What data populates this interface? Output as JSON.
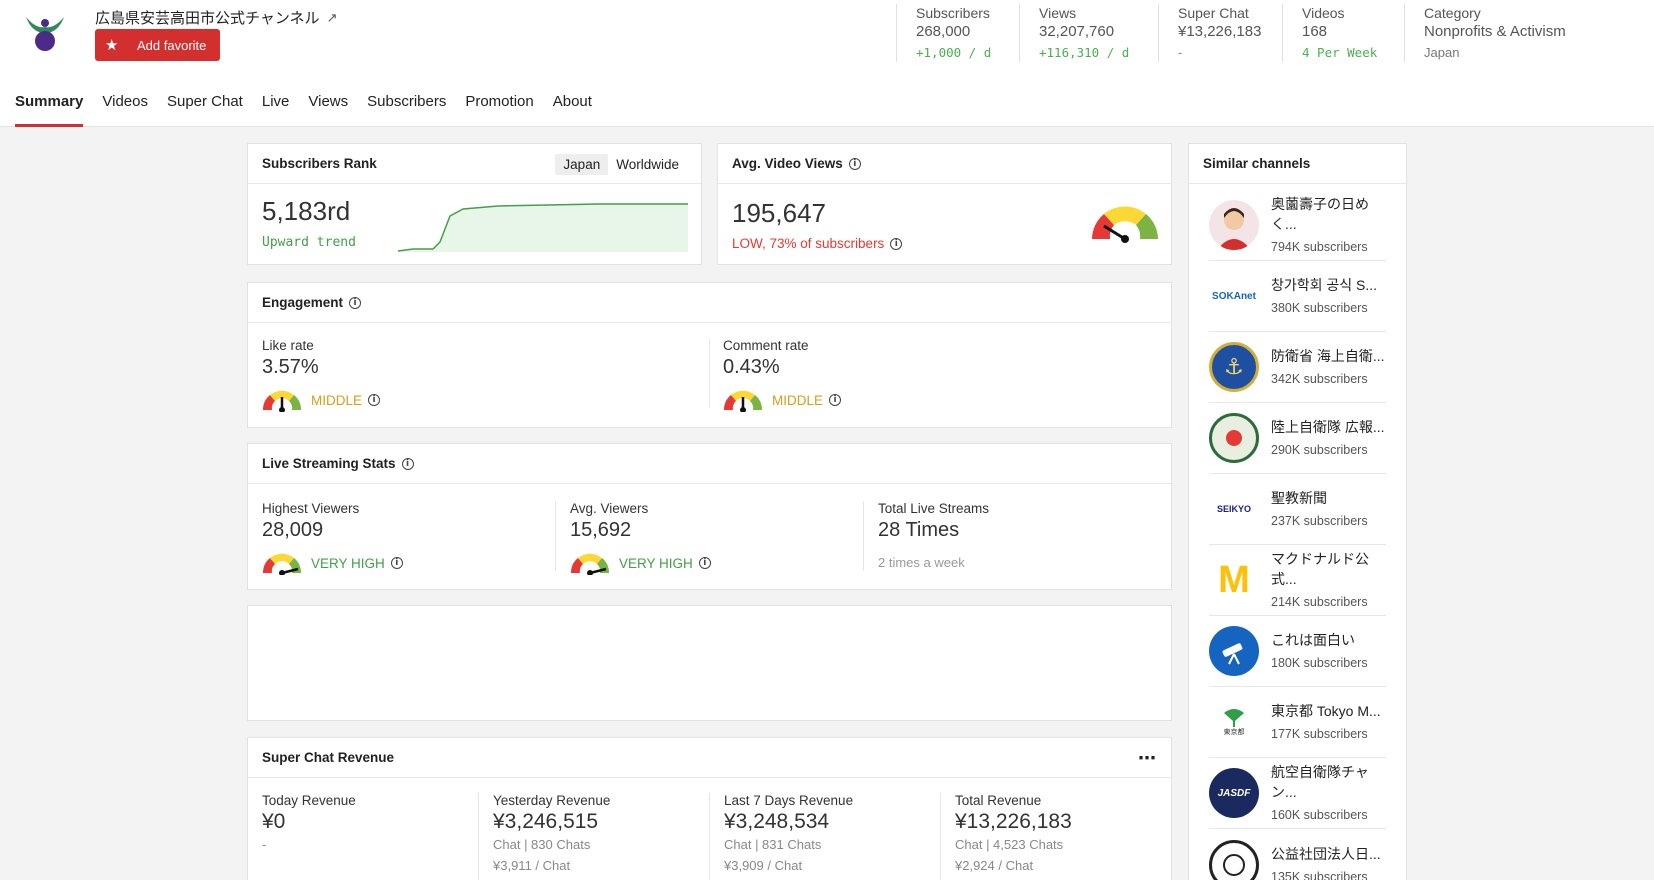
{
  "channel": {
    "title": "広島県安芸高田市公式チャンネル",
    "favorite_label": "Add favorite"
  },
  "stats": [
    {
      "label": "Subscribers",
      "value": "268,000",
      "sub": "+1,000 / d",
      "sub_style": "green"
    },
    {
      "label": "Views",
      "value": "32,207,760",
      "sub": "+116,310 / d",
      "sub_style": "green"
    },
    {
      "label": "Super Chat",
      "value": "¥13,226,183",
      "sub": "-",
      "sub_style": "gray"
    },
    {
      "label": "Videos",
      "value": "168",
      "sub": "4 Per Week",
      "sub_style": "green"
    },
    {
      "label": "Category",
      "value": "Nonprofits & Activism",
      "sub": "Japan",
      "sub_style": "plain"
    }
  ],
  "tabs": [
    "Summary",
    "Videos",
    "Super Chat",
    "Live",
    "Views",
    "Subscribers",
    "Promotion",
    "About"
  ],
  "rank": {
    "title": "Subscribers Rank",
    "seg_japan": "Japan",
    "seg_world": "Worldwide",
    "value": "5,183rd",
    "trend": "Upward trend"
  },
  "avg_views": {
    "title": "Avg. Video Views",
    "value": "195,647",
    "note": "LOW, 73% of subscribers"
  },
  "engagement": {
    "title": "Engagement",
    "like": {
      "label": "Like rate",
      "value": "3.57%",
      "level": "MIDDLE"
    },
    "comment": {
      "label": "Comment rate",
      "value": "0.43%",
      "level": "MIDDLE"
    }
  },
  "live": {
    "title": "Live Streaming Stats",
    "highest": {
      "label": "Highest Viewers",
      "value": "28,009",
      "level": "VERY HIGH"
    },
    "avg": {
      "label": "Avg. Viewers",
      "value": "15,692",
      "level": "VERY HIGH"
    },
    "total": {
      "label": "Total Live Streams",
      "value": "28 Times",
      "note": "2 times a week"
    }
  },
  "superchat": {
    "title": "Super Chat Revenue",
    "today": {
      "label": "Today Revenue",
      "value": "¥0",
      "line1": "-"
    },
    "yesterday": {
      "label": "Yesterday Revenue",
      "value": "¥3,246,515",
      "line1": "Chat | 830 Chats",
      "line2": "¥3,911 / Chat"
    },
    "last7": {
      "label": "Last 7 Days Revenue",
      "value": "¥3,248,534",
      "line1": "Chat | 831 Chats",
      "line2": "¥3,909 / Chat"
    },
    "total": {
      "label": "Total Revenue",
      "value": "¥13,226,183",
      "line1": "Chat | 4,523 Chats",
      "line2": "¥2,924 / Chat"
    }
  },
  "similar": {
    "title": "Similar channels",
    "items": [
      {
        "name": "奥薗壽子の日めく...",
        "subs": "794K subscribers",
        "icon": "person-avatar"
      },
      {
        "name": "창가학회 공식 S...",
        "subs": "380K subscribers",
        "icon": "sokanet-logo",
        "logo_text": "SOKAnet"
      },
      {
        "name": "防衛省 海上自衛...",
        "subs": "342K subscribers",
        "icon": "anchor-emblem"
      },
      {
        "name": "陸上自衛隊 広報...",
        "subs": "290K subscribers",
        "icon": "army-emblem"
      },
      {
        "name": "聖教新聞",
        "subs": "237K subscribers",
        "icon": "seikyo-logo",
        "logo_text": "SEIKYO"
      },
      {
        "name": "マクドナルド公式...",
        "subs": "214K subscribers",
        "icon": "mcdonalds-logo",
        "logo_text": "M"
      },
      {
        "name": "これは面白い",
        "subs": "180K subscribers",
        "icon": "telescope-icon"
      },
      {
        "name": "東京都 Tokyo M...",
        "subs": "177K subscribers",
        "icon": "ginkgo-icon",
        "logo_text": "東京都"
      },
      {
        "name": "航空自衛隊チャン...",
        "subs": "160K subscribers",
        "icon": "jasdf-logo",
        "logo_text": "JASDF"
      },
      {
        "name": "公益社団法人日...",
        "subs": "135K subscribers",
        "icon": "seal-emblem"
      }
    ]
  },
  "colors": {
    "accent": "#d32f2f",
    "green": "#43a047",
    "yellow": "#d4a017",
    "red": "#e53935"
  }
}
